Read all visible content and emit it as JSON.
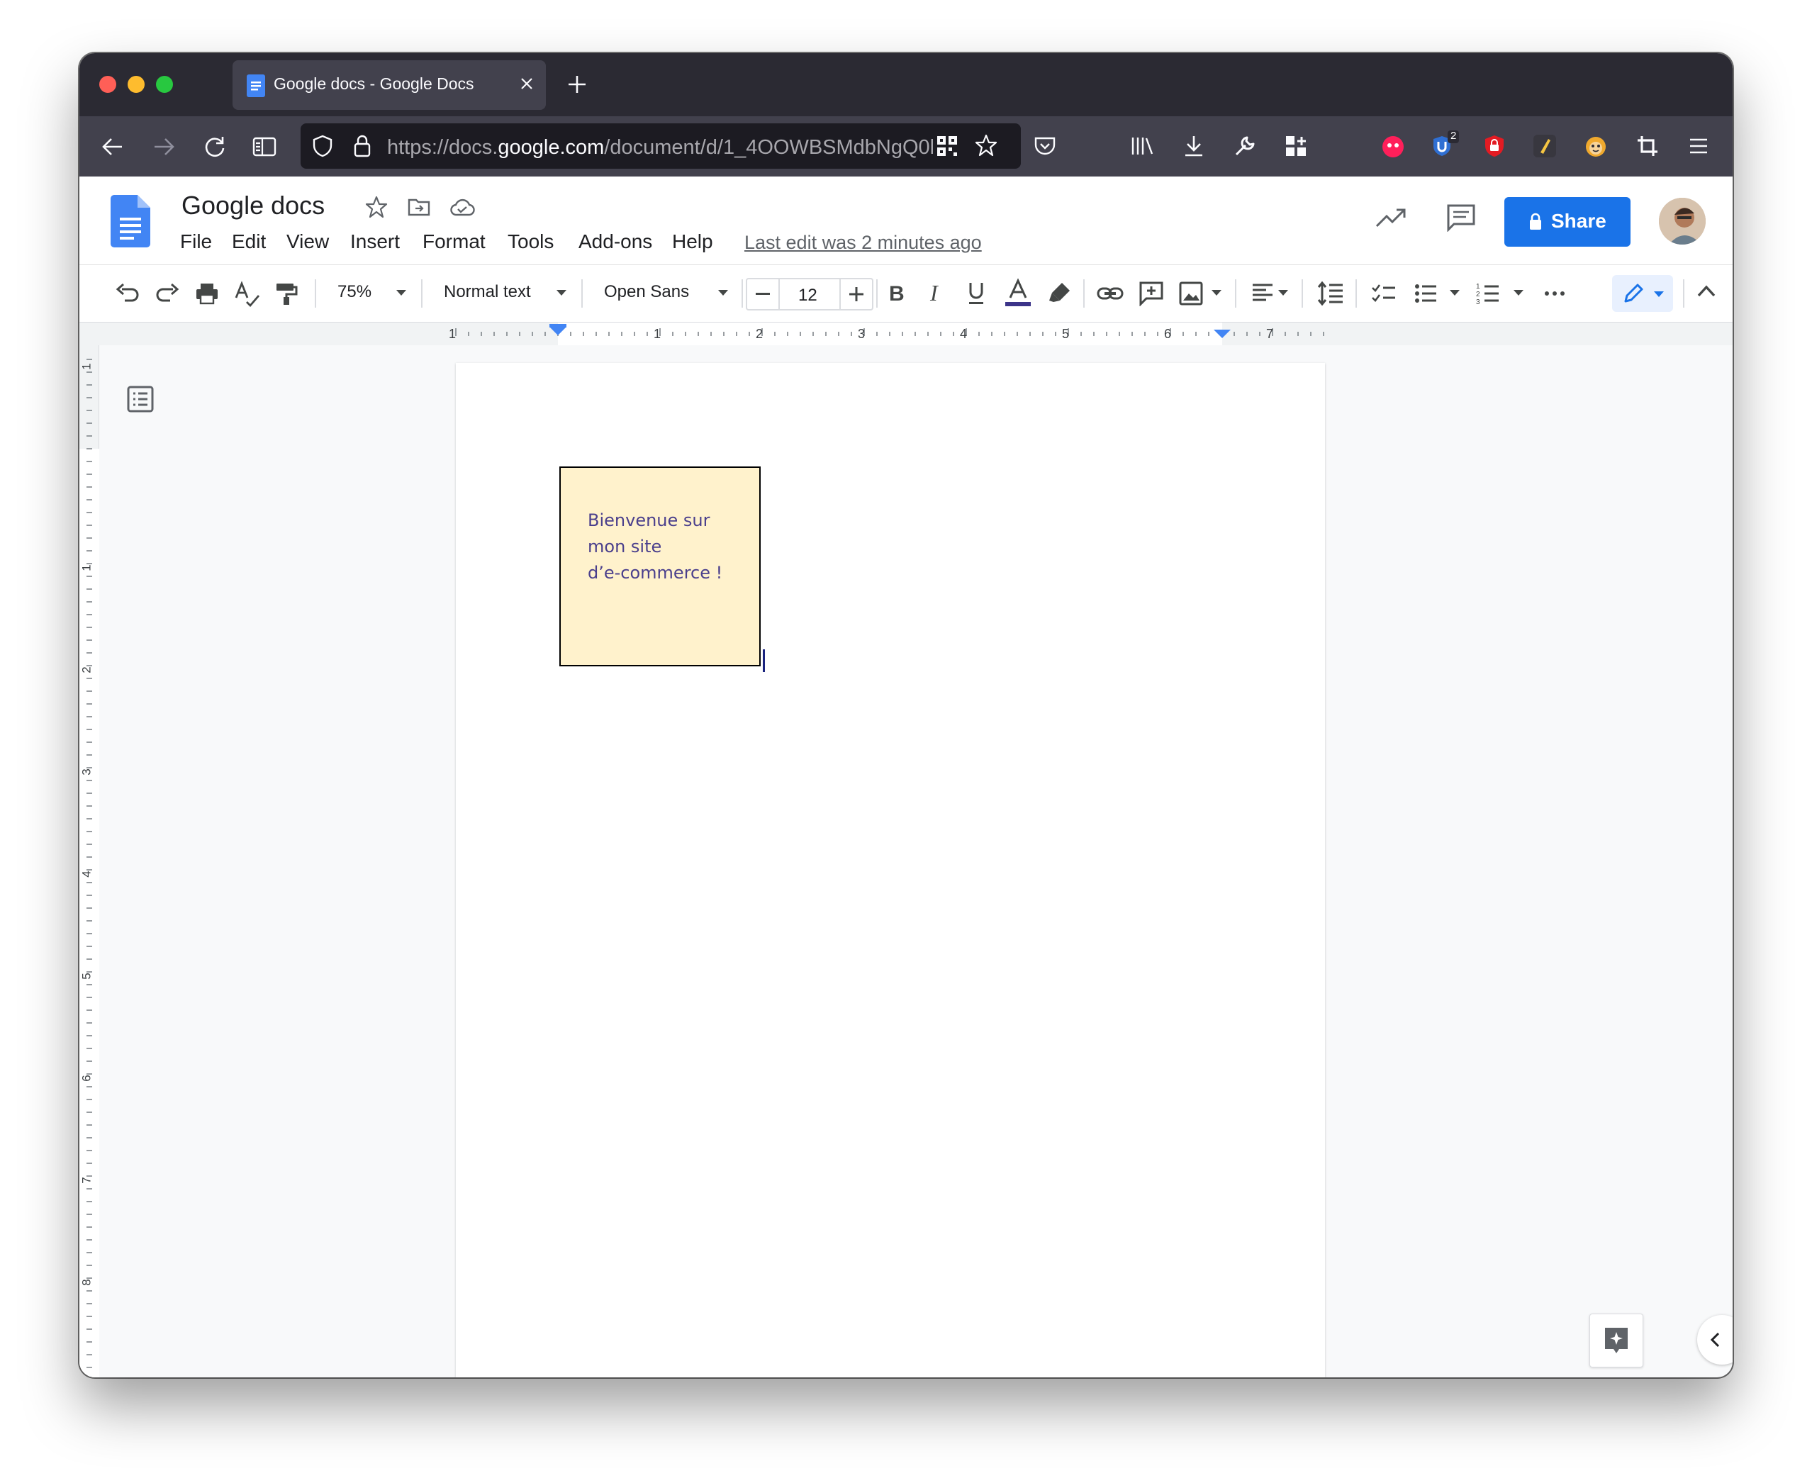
{
  "browser": {
    "tab_title": "Google docs - Google Docs",
    "url_prefix": "https://docs.",
    "url_domain": "google.com",
    "url_path": "/document/d/1_4OOWBSMdbNgQ0l",
    "extension_badge_count": "2",
    "icons": [
      "back-arrow-icon",
      "forward-arrow-icon",
      "reload-icon",
      "reader-view-icon",
      "shield-icon",
      "lock-icon",
      "qr-code-icon",
      "star-icon",
      "pocket-icon",
      "library-icon",
      "download-icon",
      "wrench-icon",
      "extensions-icon",
      "menu-icon"
    ]
  },
  "docs": {
    "title": "Google docs",
    "menu": [
      "File",
      "Edit",
      "View",
      "Insert",
      "Format",
      "Tools",
      "Add-ons",
      "Help"
    ],
    "last_edit": "Last edit was 2 minutes ago",
    "share_label": "Share"
  },
  "toolbar": {
    "zoom": "75%",
    "style": "Normal text",
    "font": "Open Sans",
    "font_size": "12"
  },
  "ruler": {
    "h_numbers": [
      "1",
      "1",
      "2",
      "3",
      "4",
      "5",
      "6",
      "7"
    ],
    "v_numbers": [
      "1",
      "1",
      "2",
      "3",
      "4",
      "5",
      "6",
      "7",
      "8"
    ]
  },
  "document": {
    "textbox_lines": [
      "Bienvenue sur",
      "mon site",
      "d’e-commerce !"
    ],
    "textbox_fill": "#fff2cc",
    "text_color": "#4a3f8c"
  },
  "colors": {
    "accent": "#1a73e8",
    "tabstrip": "#2b2a33",
    "navbar": "#42414d"
  }
}
